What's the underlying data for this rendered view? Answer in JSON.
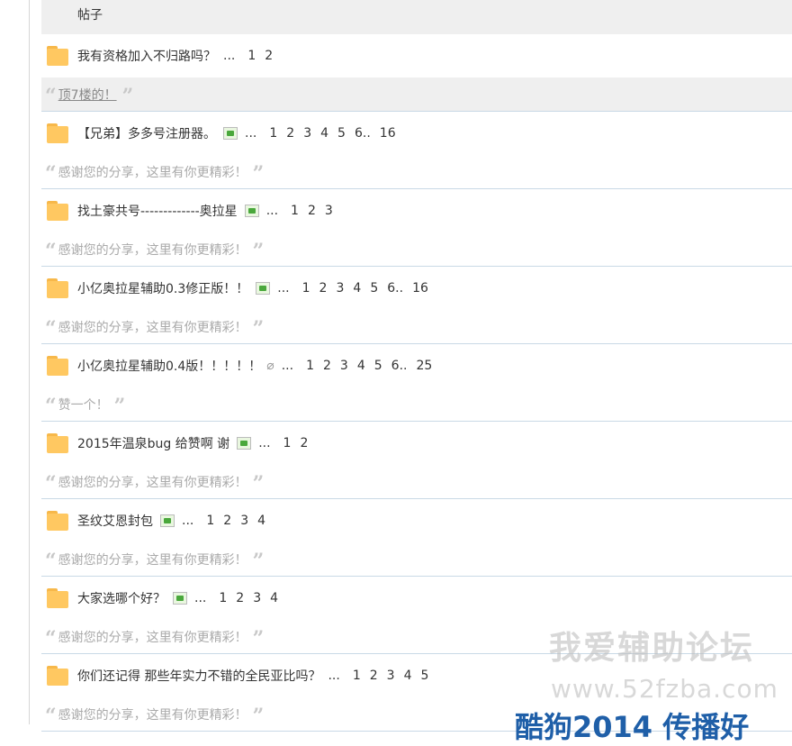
{
  "header": {
    "label": "帖子"
  },
  "posts": [
    {
      "title": "我有资格加入不归路吗？",
      "has_image": false,
      "has_attachment": false,
      "ellipsis": "...",
      "pages": [
        "1",
        "2"
      ],
      "reply": "顶7楼的！",
      "reply_highlight": true
    },
    {
      "title": "【兄弟】多多号注册器。",
      "has_image": true,
      "has_attachment": false,
      "ellipsis": "...",
      "pages": [
        "1",
        "2",
        "3",
        "4",
        "5",
        "6",
        "..",
        "16"
      ],
      "reply": "感谢您的分享，这里有你更精彩！",
      "reply_highlight": false
    },
    {
      "title": "找土豪共号-------------奥拉星",
      "has_image": true,
      "has_attachment": false,
      "ellipsis": "...",
      "pages": [
        "1",
        "2",
        "3"
      ],
      "reply": "感谢您的分享，这里有你更精彩！",
      "reply_highlight": false
    },
    {
      "title": "小亿奥拉星辅助0.3修正版！！",
      "has_image": true,
      "has_attachment": false,
      "ellipsis": "...",
      "pages": [
        "1",
        "2",
        "3",
        "4",
        "5",
        "6",
        "..",
        "16"
      ],
      "reply": "感谢您的分享，这里有你更精彩！",
      "reply_highlight": false
    },
    {
      "title": "小亿奥拉星辅助0.4版！！！！！",
      "has_image": false,
      "has_attachment": true,
      "ellipsis": "...",
      "pages": [
        "1",
        "2",
        "3",
        "4",
        "5",
        "6",
        "..",
        "25"
      ],
      "reply": "赞一个！",
      "reply_highlight": false
    },
    {
      "title": "2015年温泉bug 给赞啊 谢",
      "has_image": true,
      "has_attachment": false,
      "ellipsis": "...",
      "pages": [
        "1",
        "2"
      ],
      "reply": "感谢您的分享，这里有你更精彩！",
      "reply_highlight": false
    },
    {
      "title": "圣纹艾恩封包",
      "has_image": true,
      "has_attachment": false,
      "ellipsis": "...",
      "pages": [
        "1",
        "2",
        "3",
        "4"
      ],
      "reply": "感谢您的分享，这里有你更精彩！",
      "reply_highlight": false
    },
    {
      "title": "大家选哪个好？",
      "has_image": true,
      "has_attachment": false,
      "ellipsis": "...",
      "pages": [
        "1",
        "2",
        "3",
        "4"
      ],
      "reply": "感谢您的分享，这里有你更精彩！",
      "reply_highlight": false
    },
    {
      "title": "你们还记得 那些年实力不错的全民亚比吗？",
      "has_image": false,
      "has_attachment": false,
      "ellipsis": "...",
      "pages": [
        "1",
        "2",
        "3",
        "4",
        "5"
      ],
      "reply": "感谢您的分享，这里有你更精彩！",
      "reply_highlight": false
    }
  ],
  "icons": {
    "folder": "folder-icon",
    "image": "image-icon",
    "attachment": "paperclip-icon",
    "quote_open": "quote-open-icon",
    "quote_close": "quote-close-icon"
  },
  "glyphs": {
    "quote_open": "“",
    "quote_close": "”",
    "attachment": "⌀"
  },
  "watermark": {
    "line1": "我爱辅助论坛",
    "line2": "www.52fzba.com",
    "line3": "酷狗2014 传播好"
  }
}
